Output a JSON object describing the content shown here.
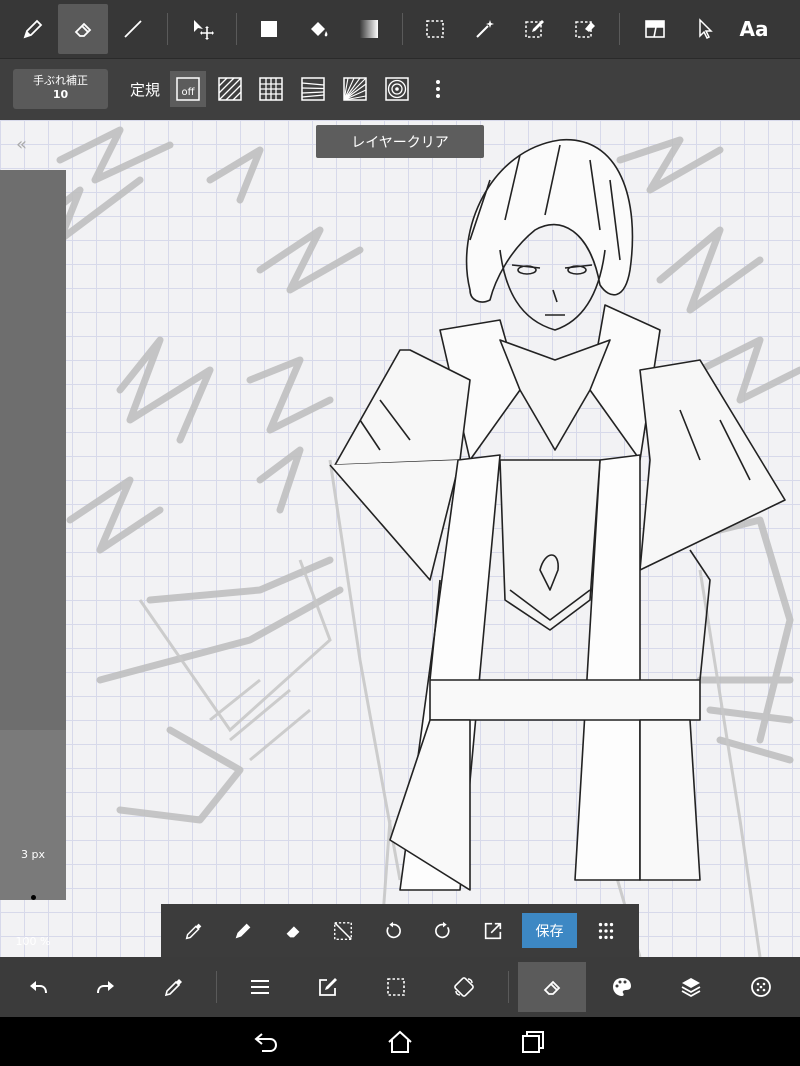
{
  "top_toolbar": {
    "tools": [
      {
        "name": "pen-tool",
        "icon": "pen-icon"
      },
      {
        "name": "eraser-tool",
        "icon": "eraser-icon",
        "selected": true
      },
      {
        "name": "line-tool",
        "icon": "line-icon"
      },
      {
        "name": "move-tool",
        "icon": "move-icon"
      },
      {
        "name": "fill-rect-tool",
        "icon": "square-icon"
      },
      {
        "name": "bucket-tool",
        "icon": "bucket-icon"
      },
      {
        "name": "gradient-tool",
        "icon": "gradient-icon"
      },
      {
        "name": "select-tool",
        "icon": "marquee-icon"
      },
      {
        "name": "magic-wand-tool",
        "icon": "magic-wand-icon"
      },
      {
        "name": "select-pen-tool",
        "icon": "select-pen-icon"
      },
      {
        "name": "select-eraser-tool",
        "icon": "select-eraser-icon"
      },
      {
        "name": "frame-divider-tool",
        "icon": "frame-icon"
      },
      {
        "name": "operation-tool",
        "icon": "pointer-icon"
      },
      {
        "name": "text-tool",
        "label": "Aa"
      }
    ]
  },
  "sub_toolbar": {
    "stabilizer_label": "手ぶれ補正",
    "stabilizer_value": "10",
    "ruler_label": "定規",
    "ruler_off_label": "off",
    "ruler_icons": [
      "parallel-ruler-icon",
      "grid-ruler-icon",
      "perspective-ruler-icon",
      "radial-ruler-icon",
      "concentric-ruler-icon",
      "more-icon"
    ]
  },
  "canvas": {
    "clear_layer_label": "レイヤークリア",
    "collapse_icon": "double-chevron-left-icon"
  },
  "left_panel": {
    "brush_size": "3 px",
    "opacity": "100 %",
    "color": "#000000"
  },
  "float_toolbar": {
    "icons": [
      "eyedropper-icon",
      "pen-icon",
      "eraser-icon",
      "deselect-icon",
      "rotate-ccw-icon",
      "rotate-cw-icon",
      "export-icon"
    ],
    "save_label": "保存",
    "menu_icon": "grid-dots-icon",
    "save_color": "#3d88c4"
  },
  "bottom_toolbar": {
    "icons": [
      "undo-icon",
      "redo-icon",
      "eyedropper-icon",
      "menu-icon",
      "edit-icon",
      "selection-icon",
      "transform-icon",
      "eraser-icon",
      "palette-icon",
      "layers-icon",
      "material-icon"
    ],
    "selected": "eraser-icon"
  },
  "nav_bar": {
    "icons": [
      "back-icon",
      "home-icon",
      "recents-icon"
    ]
  }
}
